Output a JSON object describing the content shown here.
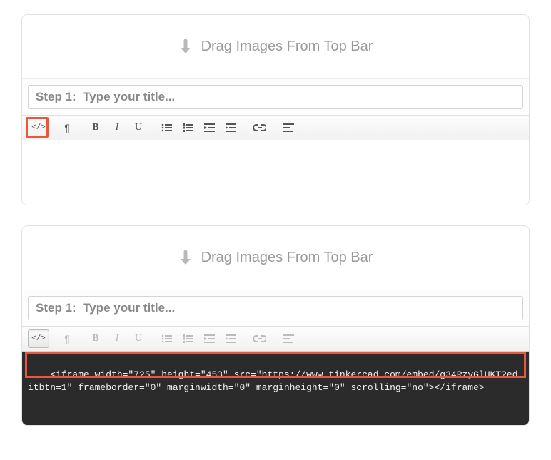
{
  "dropzone_text": "Drag Images From Top Bar",
  "step_prefix": "Step 1:",
  "title_placeholder": "Step 1:  Type your title...",
  "toolbar": {
    "code": "</>",
    "paragraph": "¶",
    "bold": "B",
    "italic": "I",
    "underline": "U"
  },
  "code_content": "<iframe width=\"725\" height=\"453\" src=\"https://www.tinkercad.com/embed/g34RzyGlUKT?editbtn=1\" frameborder=\"0\" marginwidth=\"0\" marginheight=\"0\" scrolling=\"no\"></iframe>",
  "highlight_color": "#e8573f"
}
